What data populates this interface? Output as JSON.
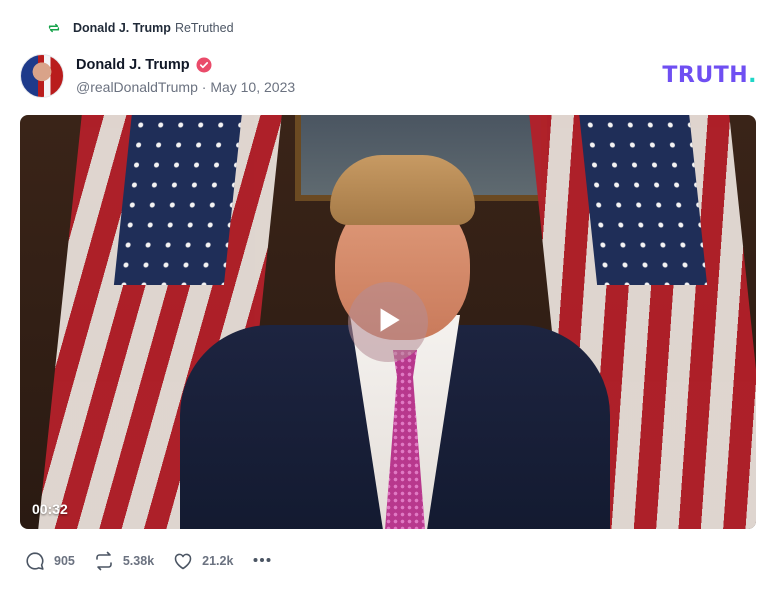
{
  "retruth": {
    "icon": "retruth-icon",
    "name": "Donald J. Trump",
    "action_text": "ReTruthed"
  },
  "post": {
    "display_name": "Donald J. Trump",
    "verified_icon": "verified-badge-icon",
    "handle": "@realDonaldTrump",
    "separator": "·",
    "date": "May 10, 2023"
  },
  "brand": {
    "logo_text": "TRUTH",
    "logo_dot": ".",
    "accent": "#6f4ff2",
    "dot_color": "#20d6c7"
  },
  "video": {
    "duration": "00:32",
    "play_icon": "play-icon"
  },
  "actions": {
    "reply": {
      "icon": "reply-icon",
      "count": "905"
    },
    "retruth": {
      "icon": "retruth-icon",
      "count": "5.38k"
    },
    "like": {
      "icon": "heart-icon",
      "count": "21.2k"
    },
    "more": {
      "icon": "more-dots-icon"
    }
  }
}
